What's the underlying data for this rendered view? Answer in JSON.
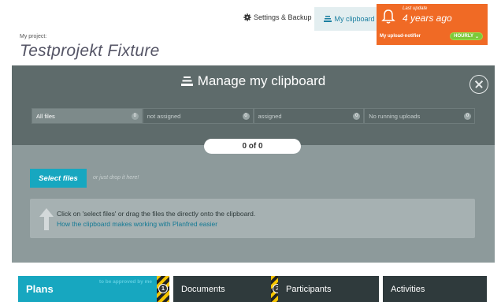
{
  "header": {
    "settings_label": "Settings & Backup",
    "clipboard_label": "My clipboard",
    "project_label": "My project:",
    "project_name": "Testprojekt Fixture"
  },
  "notifier": {
    "last_update_label": "Last update",
    "last_update_value": "4 years ago",
    "label": "My upload-notifier",
    "frequency": "HOURLY"
  },
  "panel": {
    "title": "Manage my clipboard",
    "filters": [
      {
        "label": "All files",
        "count": "0"
      },
      {
        "label": "not assigned",
        "count": "0"
      },
      {
        "label": "assigned",
        "count": "0"
      },
      {
        "label": "No running uploads",
        "count": "0"
      }
    ],
    "counter": "0 of 0",
    "select_files_label": "Select files",
    "drop_hint": "or just drop it here!",
    "info_text": "Click on 'select files' or drag the files the directly onto the clipboard.",
    "info_link": "How the clipboard makes working with Planfred easier"
  },
  "tabs": {
    "plans": "Plans",
    "plans_sub": "to be approved by me",
    "plans_badge": "1",
    "documents": "Documents",
    "documents_badge": "2",
    "participants": "Participants",
    "activities": "Activities"
  },
  "colors": {
    "accent": "#17a7c0",
    "notifier": "#f06a25",
    "panel_dark": "#5e6b6b",
    "panel_light": "#8d9a9b"
  }
}
